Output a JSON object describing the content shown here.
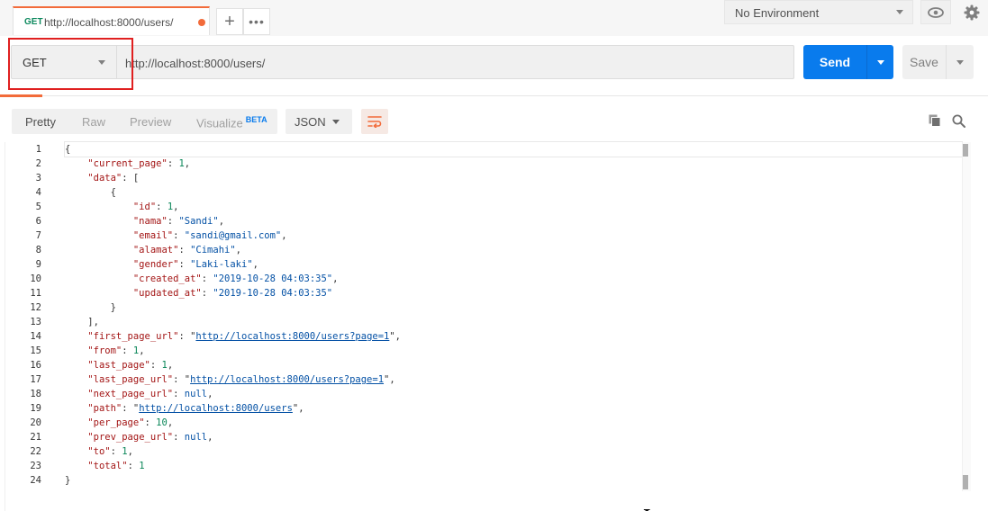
{
  "tabstrip": {
    "tab": {
      "method": "GET",
      "url": "http://localhost:8000/users/"
    },
    "add_icon": "plus-icon",
    "more_icon": "ellipsis-icon"
  },
  "environment": {
    "label": "No Environment"
  },
  "request": {
    "method": "GET",
    "url": "http://localhost:8000/users/",
    "send_label": "Send",
    "save_label": "Save"
  },
  "colors": {
    "accent": "#f26b3a",
    "send": "#097bed",
    "highlight": "#e02020"
  },
  "response": {
    "view_tabs": [
      {
        "label": "Pretty",
        "active": true
      },
      {
        "label": "Raw",
        "active": false
      },
      {
        "label": "Preview",
        "active": false
      },
      {
        "label": "Visualize",
        "badge": "BETA",
        "active": false
      }
    ],
    "format": "JSON",
    "line_numbers": [
      "1",
      "2",
      "3",
      "4",
      "5",
      "6",
      "7",
      "8",
      "9",
      "10",
      "11",
      "12",
      "13",
      "14",
      "15",
      "16",
      "17",
      "18",
      "19",
      "20",
      "21",
      "22",
      "23",
      "24"
    ],
    "body": {
      "current_page_key": "\"current_page\"",
      "current_page_val": "1",
      "data_key": "\"data\"",
      "id_key": "\"id\"",
      "id_val": "1",
      "nama_key": "\"nama\"",
      "nama_val": "\"Sandi\"",
      "email_key": "\"email\"",
      "email_val": "\"sandi@gmail.com\"",
      "alamat_key": "\"alamat\"",
      "alamat_val": "\"Cimahi\"",
      "gender_key": "\"gender\"",
      "gender_val": "\"Laki-laki\"",
      "created_at_key": "\"created_at\"",
      "created_at_val": "\"2019-10-28 04:03:35\"",
      "updated_at_key": "\"updated_at\"",
      "updated_at_val": "\"2019-10-28 04:03:35\"",
      "first_page_url_key": "\"first_page_url\"",
      "first_page_url_val": "http://localhost:8000/users?page=1",
      "from_key": "\"from\"",
      "from_val": "1",
      "last_page_key": "\"last_page\"",
      "last_page_val": "1",
      "last_page_url_key": "\"last_page_url\"",
      "last_page_url_val": "http://localhost:8000/users?page=1",
      "next_page_url_key": "\"next_page_url\"",
      "next_page_url_val": "null",
      "path_key": "\"path\"",
      "path_val": "http://localhost:8000/users",
      "per_page_key": "\"per_page\"",
      "per_page_val": "10",
      "prev_page_url_key": "\"prev_page_url\"",
      "prev_page_url_val": "null",
      "to_key": "\"to\"",
      "to_val": "1",
      "total_key": "\"total\"",
      "total_val": "1"
    }
  }
}
